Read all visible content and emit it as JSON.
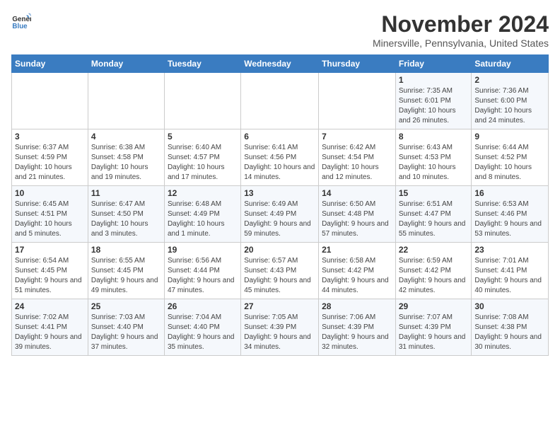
{
  "header": {
    "logo_general": "General",
    "logo_blue": "Blue",
    "month": "November 2024",
    "location": "Minersville, Pennsylvania, United States"
  },
  "days_of_week": [
    "Sunday",
    "Monday",
    "Tuesday",
    "Wednesday",
    "Thursday",
    "Friday",
    "Saturday"
  ],
  "weeks": [
    [
      {
        "day": "",
        "info": ""
      },
      {
        "day": "",
        "info": ""
      },
      {
        "day": "",
        "info": ""
      },
      {
        "day": "",
        "info": ""
      },
      {
        "day": "",
        "info": ""
      },
      {
        "day": "1",
        "info": "Sunrise: 7:35 AM\nSunset: 6:01 PM\nDaylight: 10 hours and 26 minutes."
      },
      {
        "day": "2",
        "info": "Sunrise: 7:36 AM\nSunset: 6:00 PM\nDaylight: 10 hours and 24 minutes."
      }
    ],
    [
      {
        "day": "3",
        "info": "Sunrise: 6:37 AM\nSunset: 4:59 PM\nDaylight: 10 hours and 21 minutes."
      },
      {
        "day": "4",
        "info": "Sunrise: 6:38 AM\nSunset: 4:58 PM\nDaylight: 10 hours and 19 minutes."
      },
      {
        "day": "5",
        "info": "Sunrise: 6:40 AM\nSunset: 4:57 PM\nDaylight: 10 hours and 17 minutes."
      },
      {
        "day": "6",
        "info": "Sunrise: 6:41 AM\nSunset: 4:56 PM\nDaylight: 10 hours and 14 minutes."
      },
      {
        "day": "7",
        "info": "Sunrise: 6:42 AM\nSunset: 4:54 PM\nDaylight: 10 hours and 12 minutes."
      },
      {
        "day": "8",
        "info": "Sunrise: 6:43 AM\nSunset: 4:53 PM\nDaylight: 10 hours and 10 minutes."
      },
      {
        "day": "9",
        "info": "Sunrise: 6:44 AM\nSunset: 4:52 PM\nDaylight: 10 hours and 8 minutes."
      }
    ],
    [
      {
        "day": "10",
        "info": "Sunrise: 6:45 AM\nSunset: 4:51 PM\nDaylight: 10 hours and 5 minutes."
      },
      {
        "day": "11",
        "info": "Sunrise: 6:47 AM\nSunset: 4:50 PM\nDaylight: 10 hours and 3 minutes."
      },
      {
        "day": "12",
        "info": "Sunrise: 6:48 AM\nSunset: 4:49 PM\nDaylight: 10 hours and 1 minute."
      },
      {
        "day": "13",
        "info": "Sunrise: 6:49 AM\nSunset: 4:49 PM\nDaylight: 9 hours and 59 minutes."
      },
      {
        "day": "14",
        "info": "Sunrise: 6:50 AM\nSunset: 4:48 PM\nDaylight: 9 hours and 57 minutes."
      },
      {
        "day": "15",
        "info": "Sunrise: 6:51 AM\nSunset: 4:47 PM\nDaylight: 9 hours and 55 minutes."
      },
      {
        "day": "16",
        "info": "Sunrise: 6:53 AM\nSunset: 4:46 PM\nDaylight: 9 hours and 53 minutes."
      }
    ],
    [
      {
        "day": "17",
        "info": "Sunrise: 6:54 AM\nSunset: 4:45 PM\nDaylight: 9 hours and 51 minutes."
      },
      {
        "day": "18",
        "info": "Sunrise: 6:55 AM\nSunset: 4:45 PM\nDaylight: 9 hours and 49 minutes."
      },
      {
        "day": "19",
        "info": "Sunrise: 6:56 AM\nSunset: 4:44 PM\nDaylight: 9 hours and 47 minutes."
      },
      {
        "day": "20",
        "info": "Sunrise: 6:57 AM\nSunset: 4:43 PM\nDaylight: 9 hours and 45 minutes."
      },
      {
        "day": "21",
        "info": "Sunrise: 6:58 AM\nSunset: 4:42 PM\nDaylight: 9 hours and 44 minutes."
      },
      {
        "day": "22",
        "info": "Sunrise: 6:59 AM\nSunset: 4:42 PM\nDaylight: 9 hours and 42 minutes."
      },
      {
        "day": "23",
        "info": "Sunrise: 7:01 AM\nSunset: 4:41 PM\nDaylight: 9 hours and 40 minutes."
      }
    ],
    [
      {
        "day": "24",
        "info": "Sunrise: 7:02 AM\nSunset: 4:41 PM\nDaylight: 9 hours and 39 minutes."
      },
      {
        "day": "25",
        "info": "Sunrise: 7:03 AM\nSunset: 4:40 PM\nDaylight: 9 hours and 37 minutes."
      },
      {
        "day": "26",
        "info": "Sunrise: 7:04 AM\nSunset: 4:40 PM\nDaylight: 9 hours and 35 minutes."
      },
      {
        "day": "27",
        "info": "Sunrise: 7:05 AM\nSunset: 4:39 PM\nDaylight: 9 hours and 34 minutes."
      },
      {
        "day": "28",
        "info": "Sunrise: 7:06 AM\nSunset: 4:39 PM\nDaylight: 9 hours and 32 minutes."
      },
      {
        "day": "29",
        "info": "Sunrise: 7:07 AM\nSunset: 4:39 PM\nDaylight: 9 hours and 31 minutes."
      },
      {
        "day": "30",
        "info": "Sunrise: 7:08 AM\nSunset: 4:38 PM\nDaylight: 9 hours and 30 minutes."
      }
    ]
  ]
}
